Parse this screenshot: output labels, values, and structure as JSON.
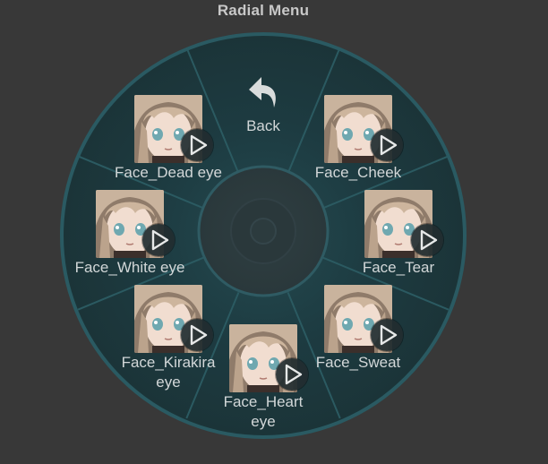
{
  "window": {
    "title": "Radial Menu"
  },
  "back": {
    "label": "Back",
    "icon": "back-arrow-icon"
  },
  "items": [
    {
      "label": "Face_Cheek"
    },
    {
      "label": "Face_Tear"
    },
    {
      "label": "Face_Sweat"
    },
    {
      "label": "Face_Heart eye"
    },
    {
      "label": "Face_Kirakira eye"
    },
    {
      "label": "Face_White eye"
    },
    {
      "label": "Face_Dead eye"
    }
  ],
  "colors": {
    "background": "#383838",
    "ring": "#1f3a40",
    "ring_edge": "#2b5a61",
    "center": "#2b3a3d"
  }
}
